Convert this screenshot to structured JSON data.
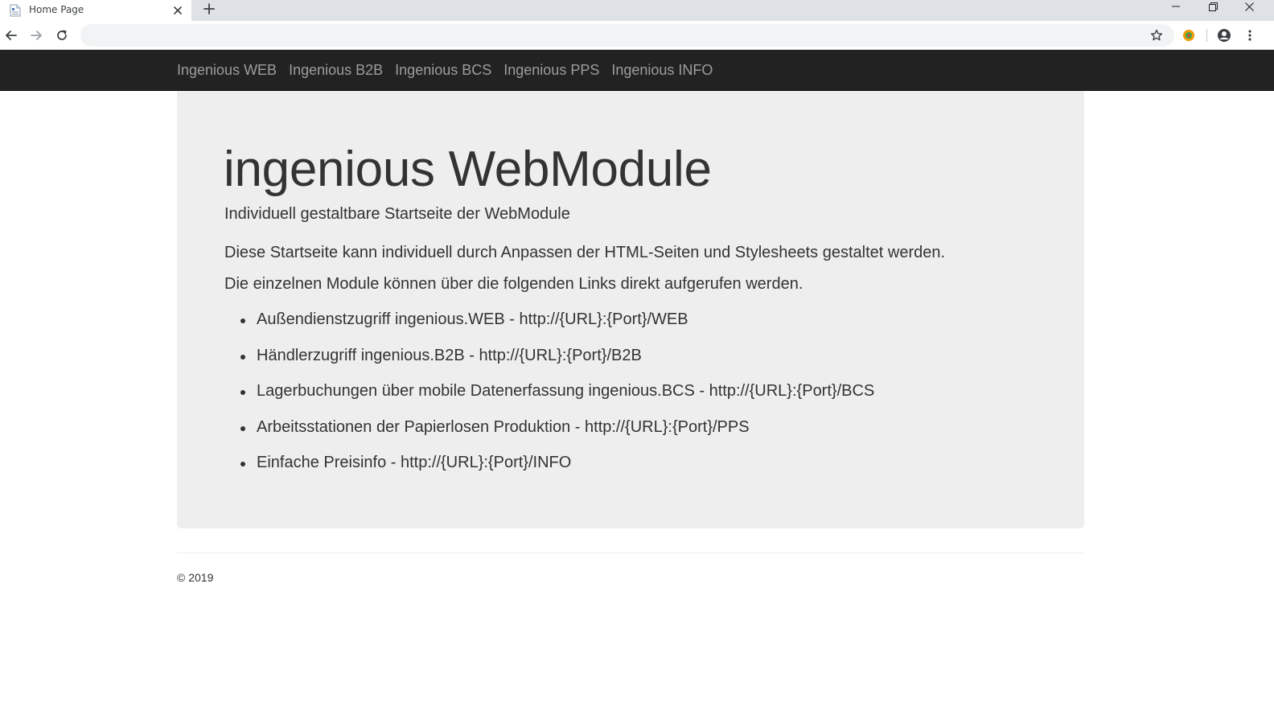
{
  "browser": {
    "tab_title": "Home Page",
    "address_value": "",
    "icons": {
      "favicon": "page-icon",
      "close": "close-icon",
      "new_tab": "plus-icon",
      "back": "arrow-left-icon",
      "forward": "arrow-right-icon",
      "reload": "reload-icon",
      "bookmark": "star-icon",
      "extension": "extension-icon",
      "profile": "account-icon",
      "menu": "kebab-menu-icon"
    }
  },
  "navbar": {
    "links": [
      {
        "label": "Ingenious WEB"
      },
      {
        "label": "Ingenious B2B"
      },
      {
        "label": "Ingenious BCS"
      },
      {
        "label": "Ingenious PPS"
      },
      {
        "label": "Ingenious INFO"
      }
    ]
  },
  "jumbotron": {
    "title": "ingenious WebModule",
    "lead": "Individuell gestaltbare Startseite der WebModule",
    "paragraph1": "Diese Startseite kann individuell durch Anpassen der HTML-Seiten und Stylesheets gestaltet werden.",
    "paragraph2": "Die einzelnen Module können über die folgenden Links direkt aufgerufen werden.",
    "modules": [
      {
        "text": "Außendienstzugriff ingenious.WEB - http://{URL}:{Port}/WEB"
      },
      {
        "text": "Händlerzugriff ingenious.B2B - http://{URL}:{Port}/B2B"
      },
      {
        "text": "Lagerbuchungen über mobile Datenerfassung ingenious.BCS - http://{URL}:{Port}/BCS"
      },
      {
        "text": "Arbeitsstationen der Papierlosen Produktion - http://{URL}:{Port}/PPS"
      },
      {
        "text": "Einfache Preisinfo - http://{URL}:{Port}/INFO"
      }
    ]
  },
  "footer": {
    "copyright": "© 2019"
  },
  "colors": {
    "navbar_bg": "#222222",
    "navbar_link": "#9d9d9d",
    "jumbotron_bg": "#eeeeee",
    "text": "#333333",
    "tabbar_bg": "#dee1e6"
  }
}
